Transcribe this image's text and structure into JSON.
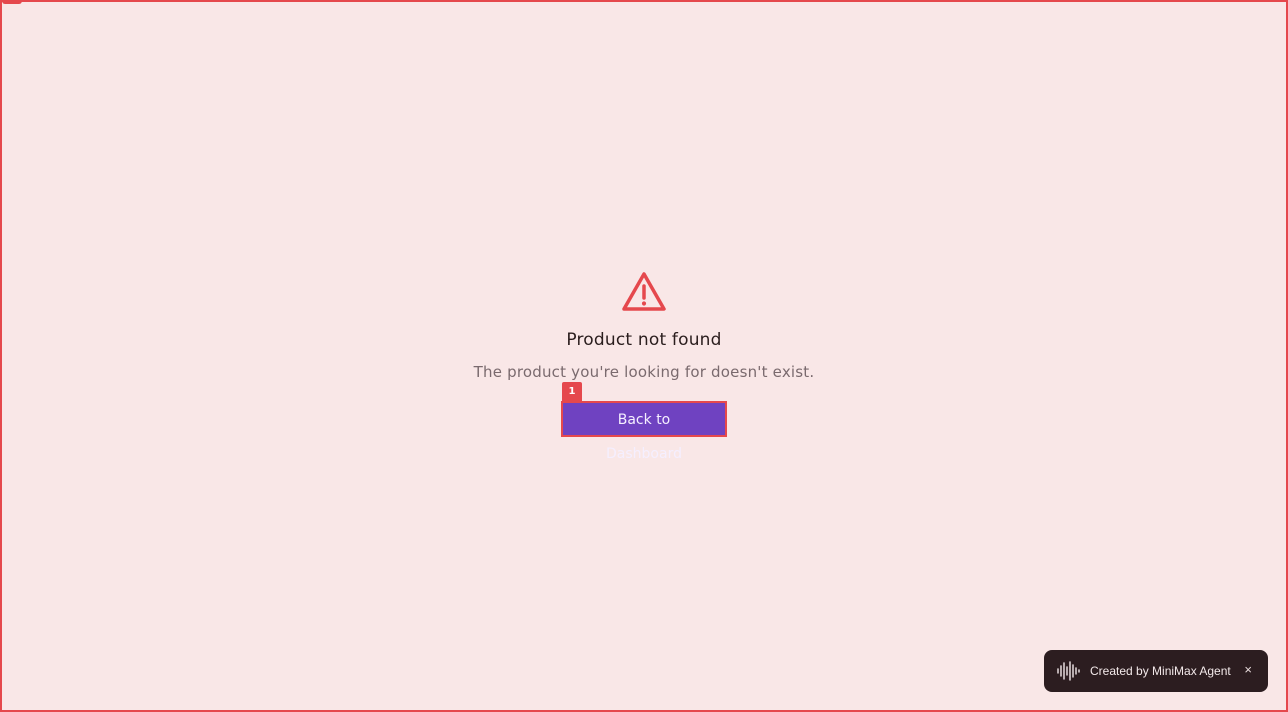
{
  "error": {
    "icon": "warning-triangle-icon",
    "title": "Product not found",
    "message": "The product you're looking for doesn't exist."
  },
  "actions": {
    "back_label": "Back to Dashboard",
    "badge_number": "1"
  },
  "toast": {
    "icon": "sound-wave-icon",
    "text": "Created by MiniMax Agent",
    "close_glyph": "×"
  },
  "colors": {
    "background": "#f9e7e7",
    "accent_red": "#e5484d",
    "button_purple": "#6f42c1",
    "toast_bg": "#2c1d20"
  }
}
